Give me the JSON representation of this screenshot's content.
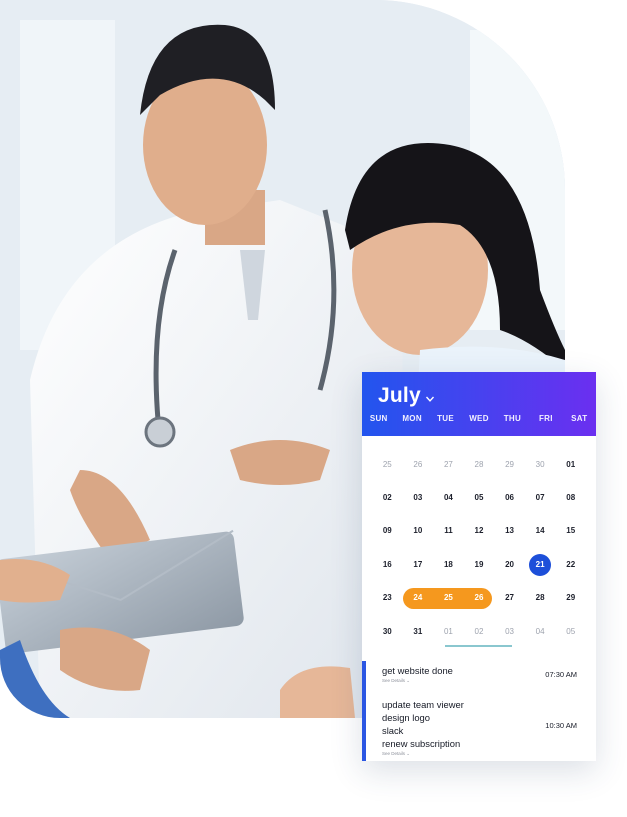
{
  "calendar": {
    "month": "July",
    "weekdays": [
      "SUN",
      "MON",
      "TUE",
      "WED",
      "THU",
      "FRI",
      "SAT"
    ],
    "weeks": [
      [
        "25",
        "26",
        "27",
        "28",
        "29",
        "30",
        "01"
      ],
      [
        "02",
        "03",
        "04",
        "05",
        "06",
        "07",
        "08"
      ],
      [
        "09",
        "10",
        "11",
        "12",
        "13",
        "14",
        "15"
      ],
      [
        "16",
        "17",
        "18",
        "19",
        "20",
        "21",
        "22"
      ],
      [
        "23",
        "24",
        "25",
        "26",
        "27",
        "28",
        "29"
      ],
      [
        "30",
        "31",
        "01",
        "02",
        "03",
        "04",
        "05"
      ]
    ],
    "selected_day": "21",
    "range_days": [
      "24",
      "25",
      "26"
    ],
    "colors": {
      "header_start": "#2255ee",
      "header_end": "#6b2ff0",
      "today": "#1d4fd9",
      "range": "#f5981e",
      "event_bar": "#2b56e3"
    }
  },
  "events": [
    {
      "titles": [
        "get website done"
      ],
      "details_label": "See Details ⌄",
      "time": "07:30 AM"
    },
    {
      "titles": [
        "update team viewer",
        "design logo",
        "slack",
        "renew subscription"
      ],
      "details_label": "See Details ⌄",
      "time": "10:30 AM"
    }
  ]
}
